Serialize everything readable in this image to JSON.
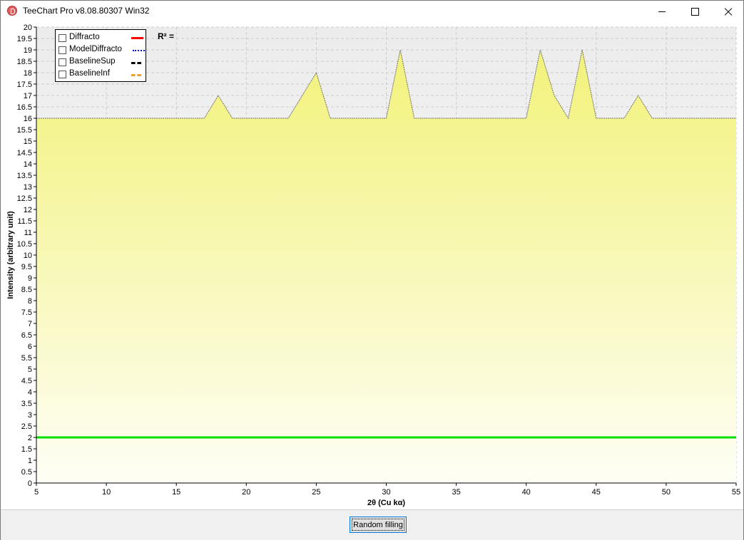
{
  "window": {
    "title": "TeeChart Pro v8.08.80307 Win32"
  },
  "legend": {
    "items": [
      {
        "label": "Diffracto",
        "color": "#ff0000",
        "style": "solid"
      },
      {
        "label": "ModelDiffracto",
        "color": "#0000ff",
        "style": "dotted"
      },
      {
        "label": "BaselineSup",
        "color": "#000000",
        "style": "dash-dot"
      },
      {
        "label": "BaselineInf",
        "color": "#f0a030",
        "style": "dash-dot"
      }
    ]
  },
  "r2_label": "R² =",
  "button": {
    "random_filling": "Random filling"
  },
  "chart_data": {
    "type": "area",
    "xlabel": "2θ (Cu kα)",
    "ylabel": "Intensity (arbitrary unit)",
    "xlim": [
      5,
      55
    ],
    "ylim": [
      0,
      20
    ],
    "x_ticks": [
      5,
      10,
      15,
      20,
      25,
      30,
      35,
      40,
      45,
      50,
      55
    ],
    "y_ticks": [
      "0",
      "0.5",
      "1",
      "1.5",
      "2",
      "2.5",
      "3",
      "3.5",
      "4",
      "4.5",
      "5",
      "5.5",
      "6",
      "6.5",
      "7",
      "7.5",
      "8",
      "8.5",
      "9",
      "9.5",
      "10",
      "10.5",
      "11",
      "11.5",
      "12",
      "12.5",
      "13",
      "13.5",
      "14",
      "14.5",
      "15",
      "15.5",
      "16",
      "16.5",
      "17",
      "17.5",
      "18",
      "18.5",
      "19",
      "19.5",
      "20"
    ],
    "grid": true,
    "series": [
      {
        "kind": "area",
        "color": "#f0f080",
        "x": [
          5,
          17,
          18,
          19,
          23,
          24,
          25,
          26,
          30,
          31,
          32,
          40,
          41,
          42,
          43,
          44,
          45,
          47,
          48,
          49,
          55
        ],
        "y": [
          16,
          16,
          17,
          16,
          16,
          17,
          18,
          16,
          16,
          19,
          16,
          16,
          19,
          17,
          16,
          19,
          16,
          16,
          17,
          16,
          16
        ]
      },
      {
        "kind": "line",
        "color": "#00e000",
        "x": [
          5,
          55
        ],
        "y": [
          2,
          2
        ]
      }
    ]
  }
}
